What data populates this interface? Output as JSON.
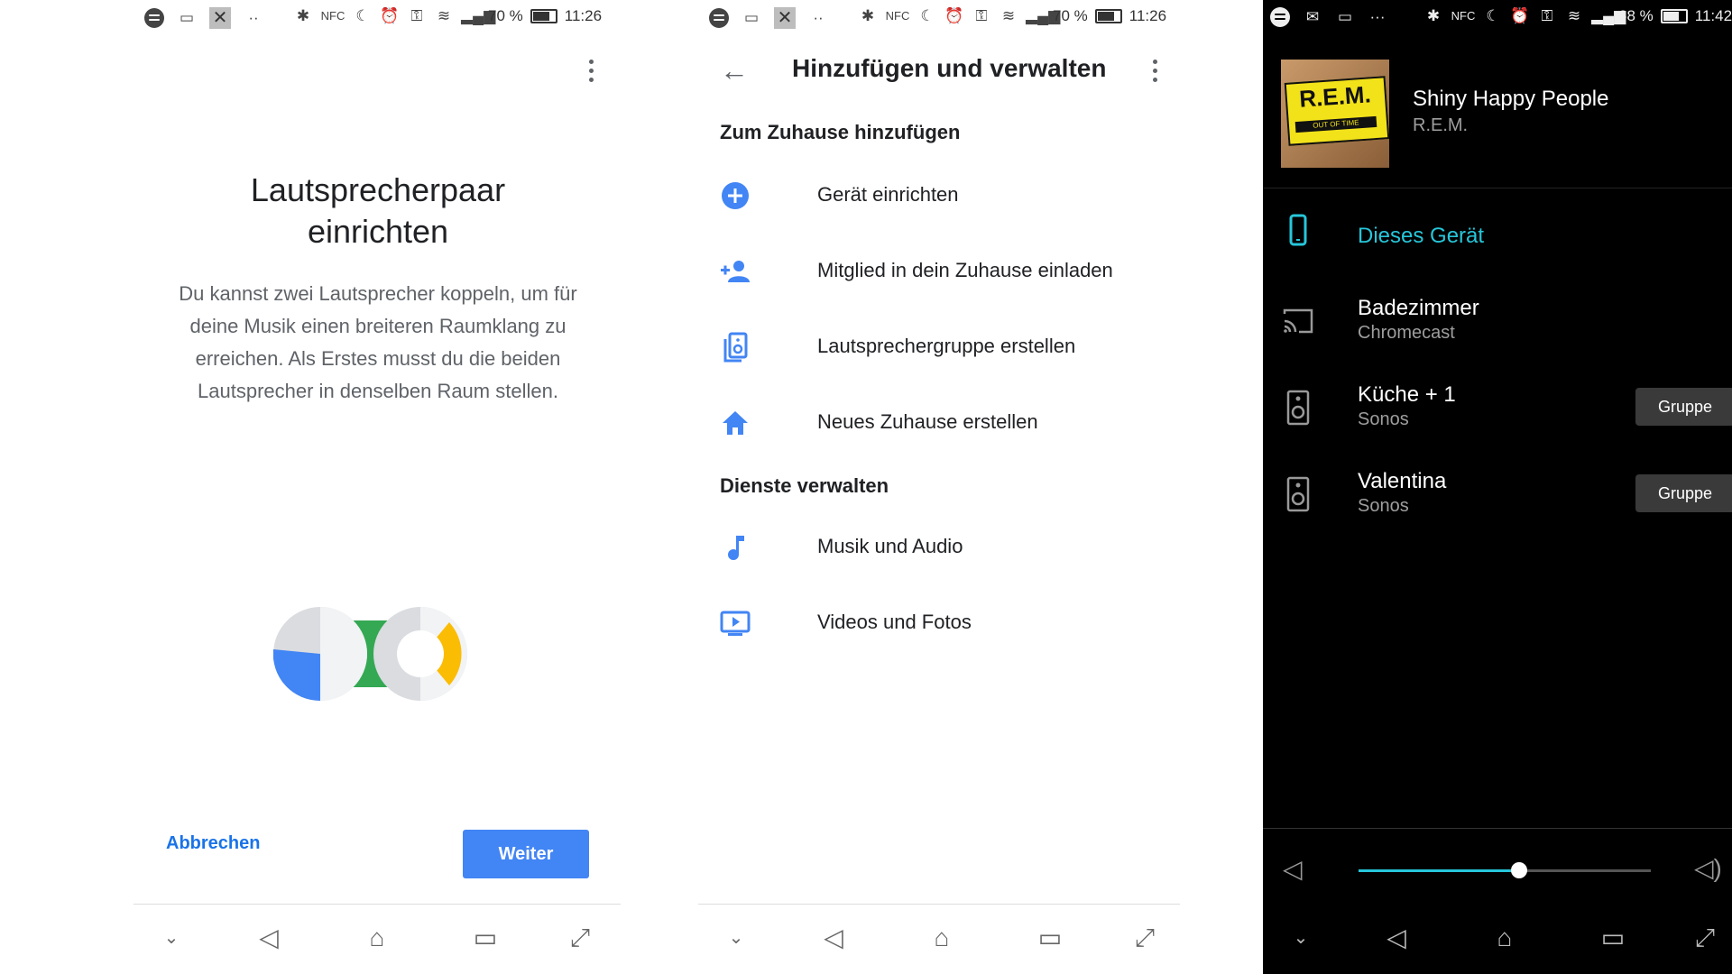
{
  "colors": {
    "accent_blue": "#4285f4",
    "link_blue": "#1a73e8",
    "cast_accent": "#26c6da"
  },
  "panel1": {
    "status": {
      "battery": "70 %",
      "time": "11:26",
      "icons": [
        "spotify-icon",
        "gallery-icon",
        "close-icon",
        "more-dots-icon",
        "bluetooth-icon",
        "nfc-icon",
        "moon-icon",
        "alarm-icon",
        "key-icon",
        "wifi-icon",
        "signal-icon",
        "battery-icon"
      ]
    },
    "title_line1": "Lautsprecherpaar",
    "title_line2": "einrichten",
    "description": "Du kannst zwei Lautsprecher koppeln, um für deine Musik einen breiteren Raumklang zu erreichen. Als Erstes musst du die beiden Lautsprecher in denselben Raum stellen.",
    "cancel_label": "Abbrechen",
    "next_label": "Weiter"
  },
  "panel2": {
    "status": {
      "battery": "70 %",
      "time": "11:26"
    },
    "title": "Hinzufügen und verwalten",
    "section_add": "Zum Zuhause hinzufügen",
    "items_add": [
      {
        "label": "Gerät einrichten",
        "icon": "add-circle-icon"
      },
      {
        "label": "Mitglied in dein Zuhause einladen",
        "icon": "add-person-icon"
      },
      {
        "label": "Lautsprechergruppe erstellen",
        "icon": "speaker-group-icon"
      },
      {
        "label": "Neues Zuhause erstellen",
        "icon": "home-icon"
      }
    ],
    "section_manage": "Dienste verwalten",
    "items_manage": [
      {
        "label": "Musik und Audio",
        "icon": "music-note-icon"
      },
      {
        "label": "Videos und Fotos",
        "icon": "video-icon"
      }
    ]
  },
  "panel3": {
    "status": {
      "battery": "68 %",
      "time": "11:42"
    },
    "cover_text": "R.E.M.",
    "cover_subtitle": "OUT OF TIME",
    "song": "Shiny Happy People",
    "artist": "R.E.M.",
    "devices": [
      {
        "name": "Dieses Gerät",
        "sub": "",
        "icon": "phone-icon",
        "active": true
      },
      {
        "name": "Badezimmer",
        "sub": "Chromecast",
        "icon": "cast-icon",
        "button": ""
      },
      {
        "name": "Küche + 1",
        "sub": "Sonos",
        "icon": "speaker-icon",
        "button": "Gruppe"
      },
      {
        "name": "Valentina",
        "sub": "Sonos",
        "icon": "speaker-icon",
        "button": "Gruppe"
      }
    ],
    "volume": 0.55
  }
}
